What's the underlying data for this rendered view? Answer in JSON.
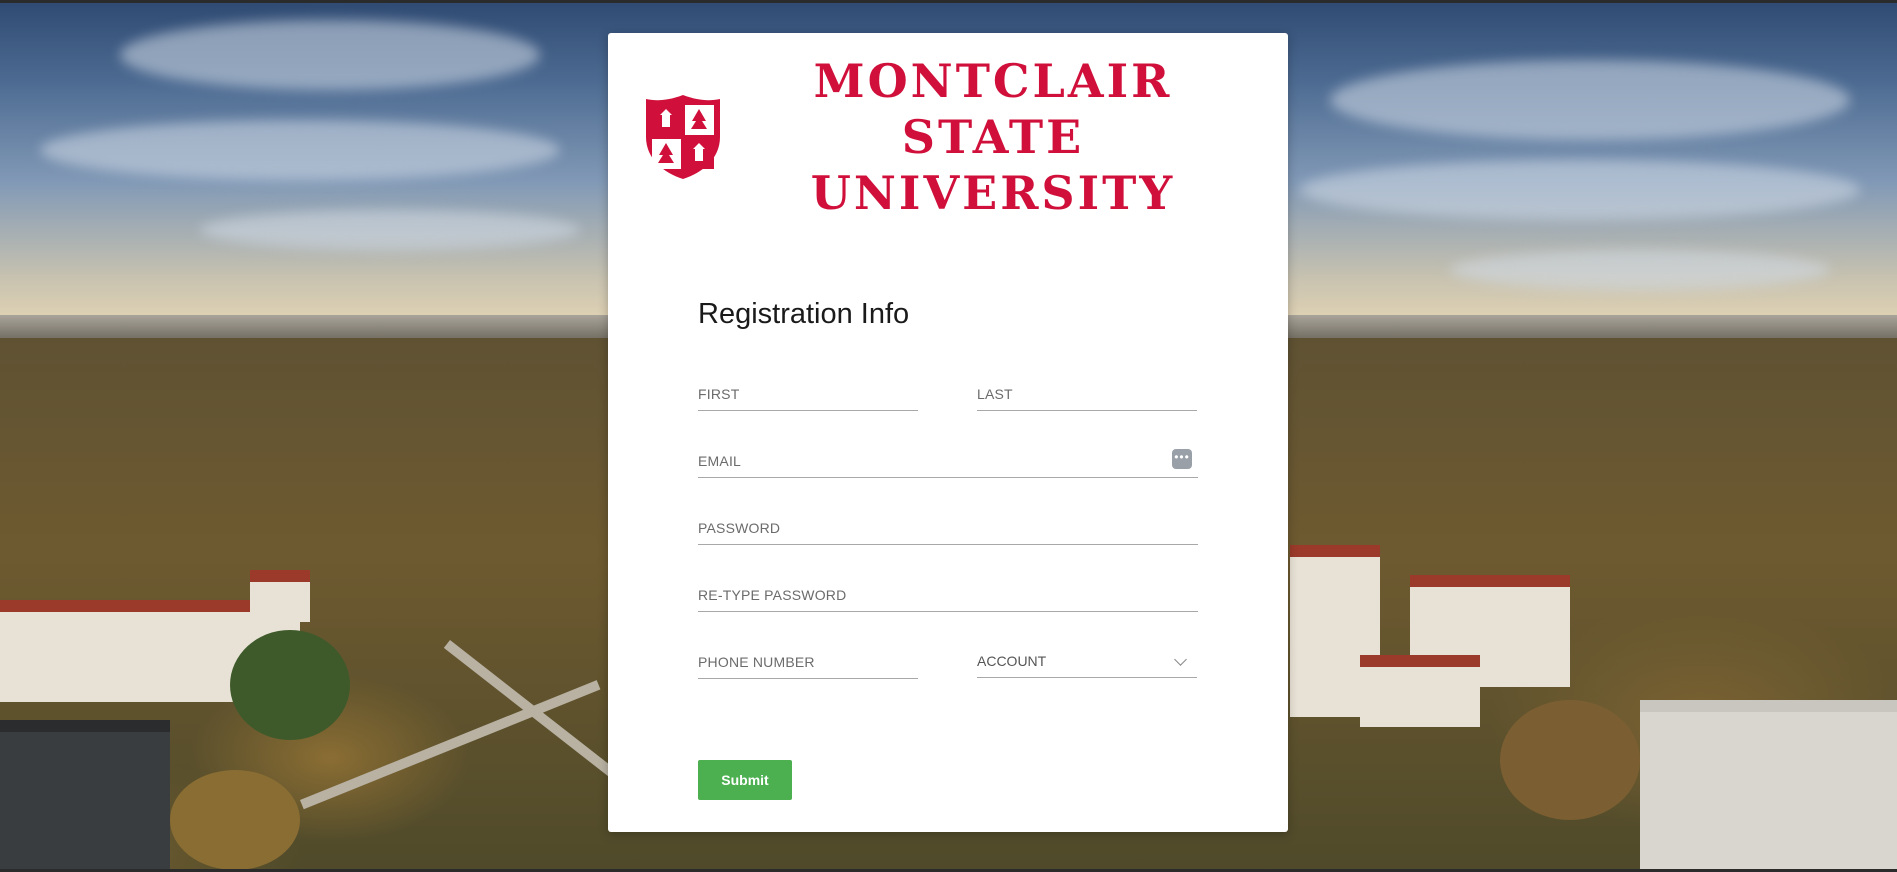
{
  "brand": {
    "line1": "MONTCLAIR STATE",
    "line2": "UNIVERSITY",
    "color": "#d0103a"
  },
  "form": {
    "title": "Registration Info",
    "first_placeholder": "FIRST",
    "last_placeholder": "LAST",
    "email_placeholder": "EMAIL",
    "password_placeholder": "PASSWORD",
    "retype_placeholder": "RE-TYPE PASSWORD",
    "phone_placeholder": "PHONE NUMBER",
    "account_value": "ACCOUNT",
    "submit_label": "Submit",
    "submit_color": "#4caf50"
  },
  "icons": {
    "password_manager": "password-manager-icon",
    "account_dropdown": "chevron-down-icon",
    "logo_shield": "shield-icon"
  }
}
